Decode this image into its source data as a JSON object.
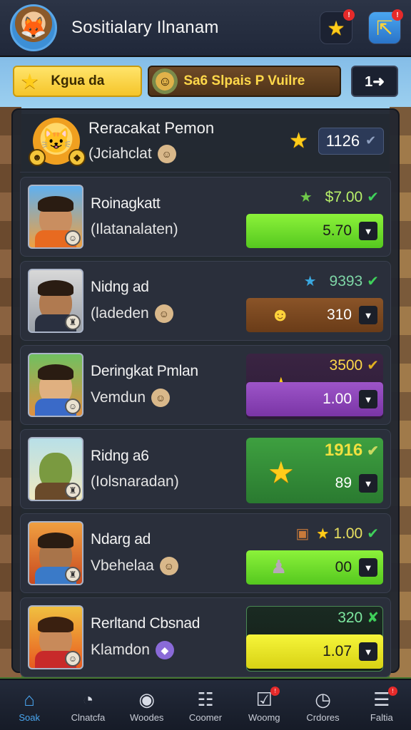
{
  "header": {
    "title": "Sositialary Ilnanam",
    "star_badge": "!",
    "share_badge": "!"
  },
  "tabs": [
    {
      "label": "Kgua da",
      "icon": "star-icon"
    },
    {
      "label": "Sa6 Slpais P Vuilre",
      "icon": "mascot-icon"
    },
    {
      "label": "1➜",
      "icon": "next-icon"
    }
  ],
  "player": {
    "title": "Reracakat Pemon",
    "subtitle": "(Jciahclat",
    "score": "1126"
  },
  "rows": [
    {
      "name": "Roinagkatt",
      "sub": "(Ilatanalaten)",
      "top_value": "$7.00",
      "box_value": "5.70",
      "box_color": "#6fdc2c"
    },
    {
      "name": "Nidng ad",
      "sub": "(ladeden",
      "top_value": "9393",
      "box_value": "310",
      "box_color": "#7a4420"
    },
    {
      "name": "Deringkat Pmlan",
      "sub": "Vemdun",
      "top_value": "3500",
      "box_value": "1.00",
      "box_color": "#8a45b8"
    },
    {
      "name": "Ridng a6",
      "sub": "(Iolsnaradan)",
      "top_value": "1916",
      "box_value": "89",
      "box_color": "#3a9a3e"
    },
    {
      "name": "Ndarg ad",
      "sub": "Vbehelaa",
      "top_value": "1.00",
      "box_value": "00",
      "box_color": "#55c81f"
    },
    {
      "name": "Rerltand Cbsnad",
      "sub": "Klamdon",
      "top_value": "320",
      "box_value": "1.07",
      "box_color": "#e8e528"
    }
  ],
  "nav": [
    {
      "label": "Soak",
      "icon": "home-icon",
      "active": true
    },
    {
      "label": "Clnatcfa",
      "icon": "chat-icon"
    },
    {
      "label": "Woodes",
      "icon": "search-icon"
    },
    {
      "label": "Coomer",
      "icon": "game-icon"
    },
    {
      "label": "Woomg",
      "icon": "mail-icon",
      "badge": "!"
    },
    {
      "label": "Crdores",
      "icon": "clock-icon"
    },
    {
      "label": "Faltia",
      "icon": "menu-icon",
      "badge": "!"
    }
  ],
  "colors": {
    "accent": "#4aa6f0",
    "gold": "#ffcc1a",
    "check_green": "#3fd05a"
  }
}
